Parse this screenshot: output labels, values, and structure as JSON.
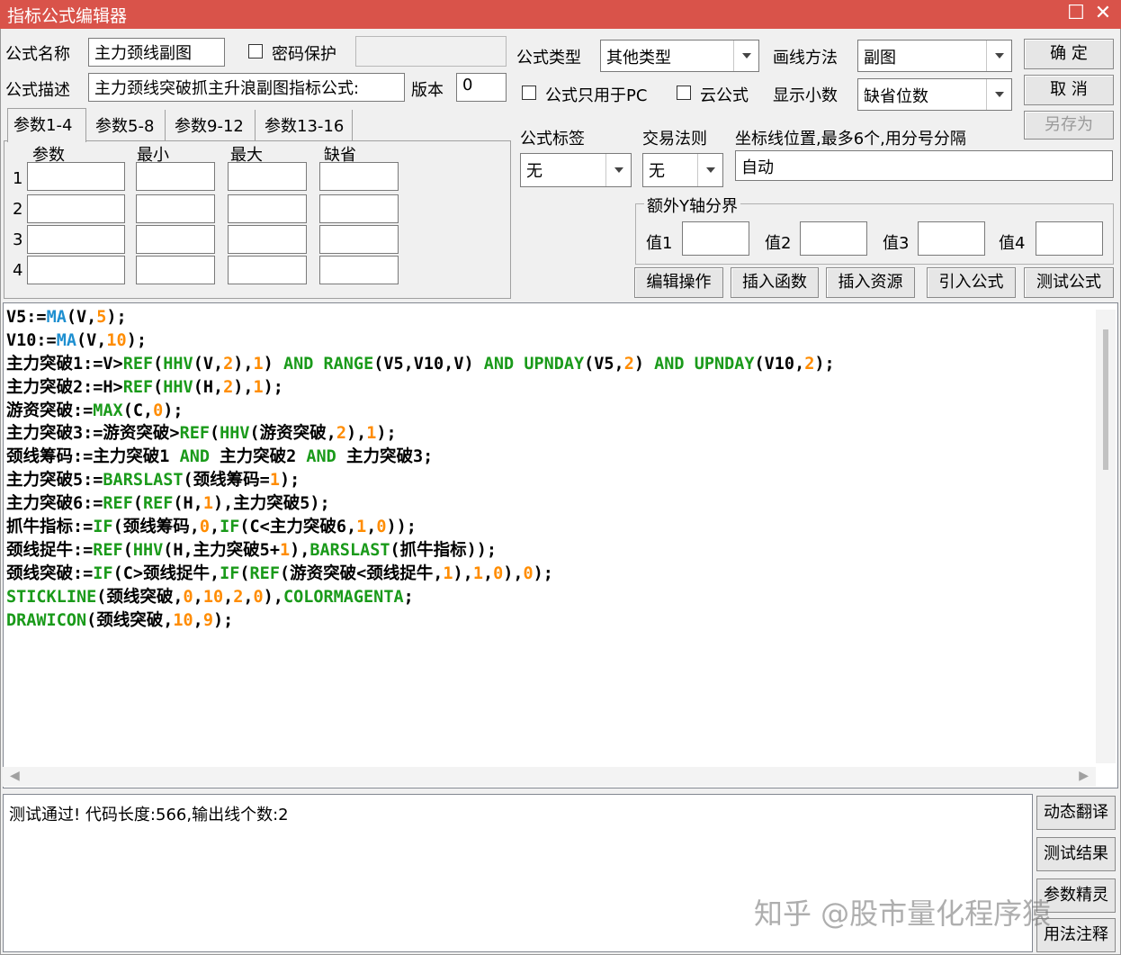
{
  "window": {
    "title": "指标公式编辑器"
  },
  "form": {
    "name_label": "公式名称",
    "name_value": "主力颈线副图",
    "password_label": "密码保护",
    "desc_label": "公式描述",
    "desc_value": "主力颈线突破抓主升浪副图指标公式:",
    "version_label": "版本",
    "version_value": "0",
    "type_label": "公式类型",
    "type_value": "其他类型",
    "draw_label": "画线方法",
    "draw_value": "副图",
    "pc_only_label": "公式只用于PC",
    "cloud_label": "云公式",
    "decimals_label": "显示小数",
    "decimals_value": "缺省位数",
    "tag_label": "公式标签",
    "tag_value": "无",
    "trade_label": "交易法则",
    "trade_value": "无",
    "coord_label": "坐标线位置,最多6个,用分号分隔",
    "coord_value": "自动",
    "yaxis_label": "额外Y轴分界",
    "val1": "值1",
    "val2": "值2",
    "val3": "值3",
    "val4": "值4"
  },
  "buttons": {
    "ok": "确  定",
    "cancel": "取  消",
    "save_as": "另存为",
    "edit_ops": "编辑操作",
    "insert_func": "插入函数",
    "insert_res": "插入资源",
    "import": "引入公式",
    "test": "测试公式",
    "dyn_translate": "动态翻译",
    "test_result": "测试结果",
    "param_wizard": "参数精灵",
    "usage_notes": "用法注释"
  },
  "tabs": [
    "参数1-4",
    "参数5-8",
    "参数9-12",
    "参数13-16"
  ],
  "params": {
    "headers": [
      "参数",
      "最小",
      "最大",
      "缺省"
    ],
    "rows": [
      "1",
      "2",
      "3",
      "4"
    ]
  },
  "code_lines": [
    [
      [
        "t",
        "V5:="
      ],
      [
        "f",
        "MA"
      ],
      [
        "t",
        "(V,"
      ],
      [
        "n",
        "5"
      ],
      [
        "t",
        ");"
      ]
    ],
    [
      [
        "t",
        "V10:="
      ],
      [
        "f",
        "MA"
      ],
      [
        "t",
        "(V,"
      ],
      [
        "n",
        "10"
      ],
      [
        "t",
        ");"
      ]
    ],
    [
      [
        "t",
        "主力突破1:=V>"
      ],
      [
        "k",
        "REF"
      ],
      [
        "t",
        "("
      ],
      [
        "k",
        "HHV"
      ],
      [
        "t",
        "(V,"
      ],
      [
        "n",
        "2"
      ],
      [
        "t",
        "),"
      ],
      [
        "n",
        "1"
      ],
      [
        "t",
        ") "
      ],
      [
        "k",
        "AND"
      ],
      [
        "t",
        " "
      ],
      [
        "k",
        "RANGE"
      ],
      [
        "t",
        "(V5,V10,V) "
      ],
      [
        "k",
        "AND"
      ],
      [
        "t",
        " "
      ],
      [
        "k",
        "UPNDAY"
      ],
      [
        "t",
        "(V5,"
      ],
      [
        "n",
        "2"
      ],
      [
        "t",
        ") "
      ],
      [
        "k",
        "AND"
      ],
      [
        "t",
        " "
      ],
      [
        "k",
        "UPNDAY"
      ],
      [
        "t",
        "(V10,"
      ],
      [
        "n",
        "2"
      ],
      [
        "t",
        ");"
      ]
    ],
    [
      [
        "t",
        "主力突破2:=H>"
      ],
      [
        "k",
        "REF"
      ],
      [
        "t",
        "("
      ],
      [
        "k",
        "HHV"
      ],
      [
        "t",
        "(H,"
      ],
      [
        "n",
        "2"
      ],
      [
        "t",
        "),"
      ],
      [
        "n",
        "1"
      ],
      [
        "t",
        ");"
      ]
    ],
    [
      [
        "t",
        "游资突破:="
      ],
      [
        "k",
        "MAX"
      ],
      [
        "t",
        "(C,"
      ],
      [
        "n",
        "0"
      ],
      [
        "t",
        ");"
      ]
    ],
    [
      [
        "t",
        "主力突破3:=游资突破>"
      ],
      [
        "k",
        "REF"
      ],
      [
        "t",
        "("
      ],
      [
        "k",
        "HHV"
      ],
      [
        "t",
        "(游资突破,"
      ],
      [
        "n",
        "2"
      ],
      [
        "t",
        "),"
      ],
      [
        "n",
        "1"
      ],
      [
        "t",
        ");"
      ]
    ],
    [
      [
        "t",
        "颈线筹码:=主力突破1 "
      ],
      [
        "k",
        "AND"
      ],
      [
        "t",
        " 主力突破2 "
      ],
      [
        "k",
        "AND"
      ],
      [
        "t",
        " 主力突破3;"
      ]
    ],
    [
      [
        "t",
        "主力突破5:="
      ],
      [
        "k",
        "BARSLAST"
      ],
      [
        "t",
        "(颈线筹码="
      ],
      [
        "n",
        "1"
      ],
      [
        "t",
        ");"
      ]
    ],
    [
      [
        "t",
        "主力突破6:="
      ],
      [
        "k",
        "REF"
      ],
      [
        "t",
        "("
      ],
      [
        "k",
        "REF"
      ],
      [
        "t",
        "(H,"
      ],
      [
        "n",
        "1"
      ],
      [
        "t",
        "),主力突破5);"
      ]
    ],
    [
      [
        "t",
        "抓牛指标:="
      ],
      [
        "k",
        "IF"
      ],
      [
        "t",
        "(颈线筹码,"
      ],
      [
        "n",
        "0"
      ],
      [
        "t",
        ","
      ],
      [
        "k",
        "IF"
      ],
      [
        "t",
        "(C<主力突破6,"
      ],
      [
        "n",
        "1"
      ],
      [
        "t",
        ","
      ],
      [
        "n",
        "0"
      ],
      [
        "t",
        "));"
      ]
    ],
    [
      [
        "t",
        "颈线捉牛:="
      ],
      [
        "k",
        "REF"
      ],
      [
        "t",
        "("
      ],
      [
        "k",
        "HHV"
      ],
      [
        "t",
        "(H,主力突破5+"
      ],
      [
        "n",
        "1"
      ],
      [
        "t",
        "),"
      ],
      [
        "k",
        "BARSLAST"
      ],
      [
        "t",
        "(抓牛指标));"
      ]
    ],
    [
      [
        "t",
        "颈线突破:="
      ],
      [
        "k",
        "IF"
      ],
      [
        "t",
        "(C>颈线捉牛,"
      ],
      [
        "k",
        "IF"
      ],
      [
        "t",
        "("
      ],
      [
        "k",
        "REF"
      ],
      [
        "t",
        "(游资突破<颈线捉牛,"
      ],
      [
        "n",
        "1"
      ],
      [
        "t",
        "),"
      ],
      [
        "n",
        "1"
      ],
      [
        "t",
        ","
      ],
      [
        "n",
        "0"
      ],
      [
        "t",
        "),"
      ],
      [
        "n",
        "0"
      ],
      [
        "t",
        ");"
      ]
    ],
    [
      [
        "k",
        "STICKLINE"
      ],
      [
        "t",
        "(颈线突破,"
      ],
      [
        "n",
        "0"
      ],
      [
        "t",
        ","
      ],
      [
        "n",
        "10"
      ],
      [
        "t",
        ","
      ],
      [
        "n",
        "2"
      ],
      [
        "t",
        ","
      ],
      [
        "n",
        "0"
      ],
      [
        "t",
        "),"
      ],
      [
        "k",
        "COLORMAGENTA"
      ],
      [
        "t",
        ";"
      ]
    ],
    [
      [
        "k",
        "DRAWICON"
      ],
      [
        "t",
        "(颈线突破,"
      ],
      [
        "n",
        "10"
      ],
      [
        "t",
        ","
      ],
      [
        "n",
        "9"
      ],
      [
        "t",
        ");"
      ]
    ]
  ],
  "output_text": "测试通过! 代码长度:566,输出线个数:2",
  "watermark": "知乎 @股市量化程序猿",
  "colors": {
    "titlebar": "#d9534a",
    "keyword": "#1a9a1a",
    "number": "#ff8c00",
    "func": "#1e8fd0"
  }
}
